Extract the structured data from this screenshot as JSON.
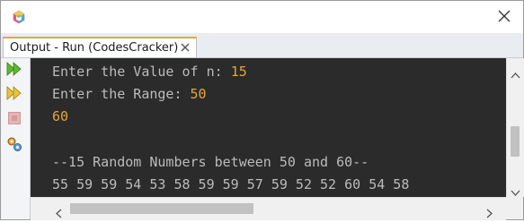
{
  "window": {
    "app_icon": "netbeans-cube-icon",
    "close_icon": "close-icon"
  },
  "tab": {
    "label": "Output - Run (CodesCracker)",
    "close_icon": "close-icon"
  },
  "toolbar": {
    "items": [
      {
        "name": "rerun-icon"
      },
      {
        "name": "rerun-with-options-icon"
      },
      {
        "name": "stop-icon"
      },
      {
        "name": "settings-icon"
      }
    ]
  },
  "console": {
    "lines": [
      {
        "prompt": "Enter the Value of n: ",
        "input": "15"
      },
      {
        "prompt": "Enter the Range: ",
        "input": "50"
      },
      {
        "prompt": "",
        "input": "60"
      },
      {
        "prompt": "",
        "input": ""
      },
      {
        "prompt": "--15 Random Numbers between 50 and 60--",
        "input": ""
      },
      {
        "prompt": "55 59 59 54 53 58 59 59 57 59 52 52 60 54 58",
        "input": ""
      }
    ]
  },
  "colors": {
    "console_bg": "#2b2b2b",
    "console_text": "#bbbbbb",
    "console_input": "#e7a43c",
    "tab_accent": "#e3a83c"
  }
}
